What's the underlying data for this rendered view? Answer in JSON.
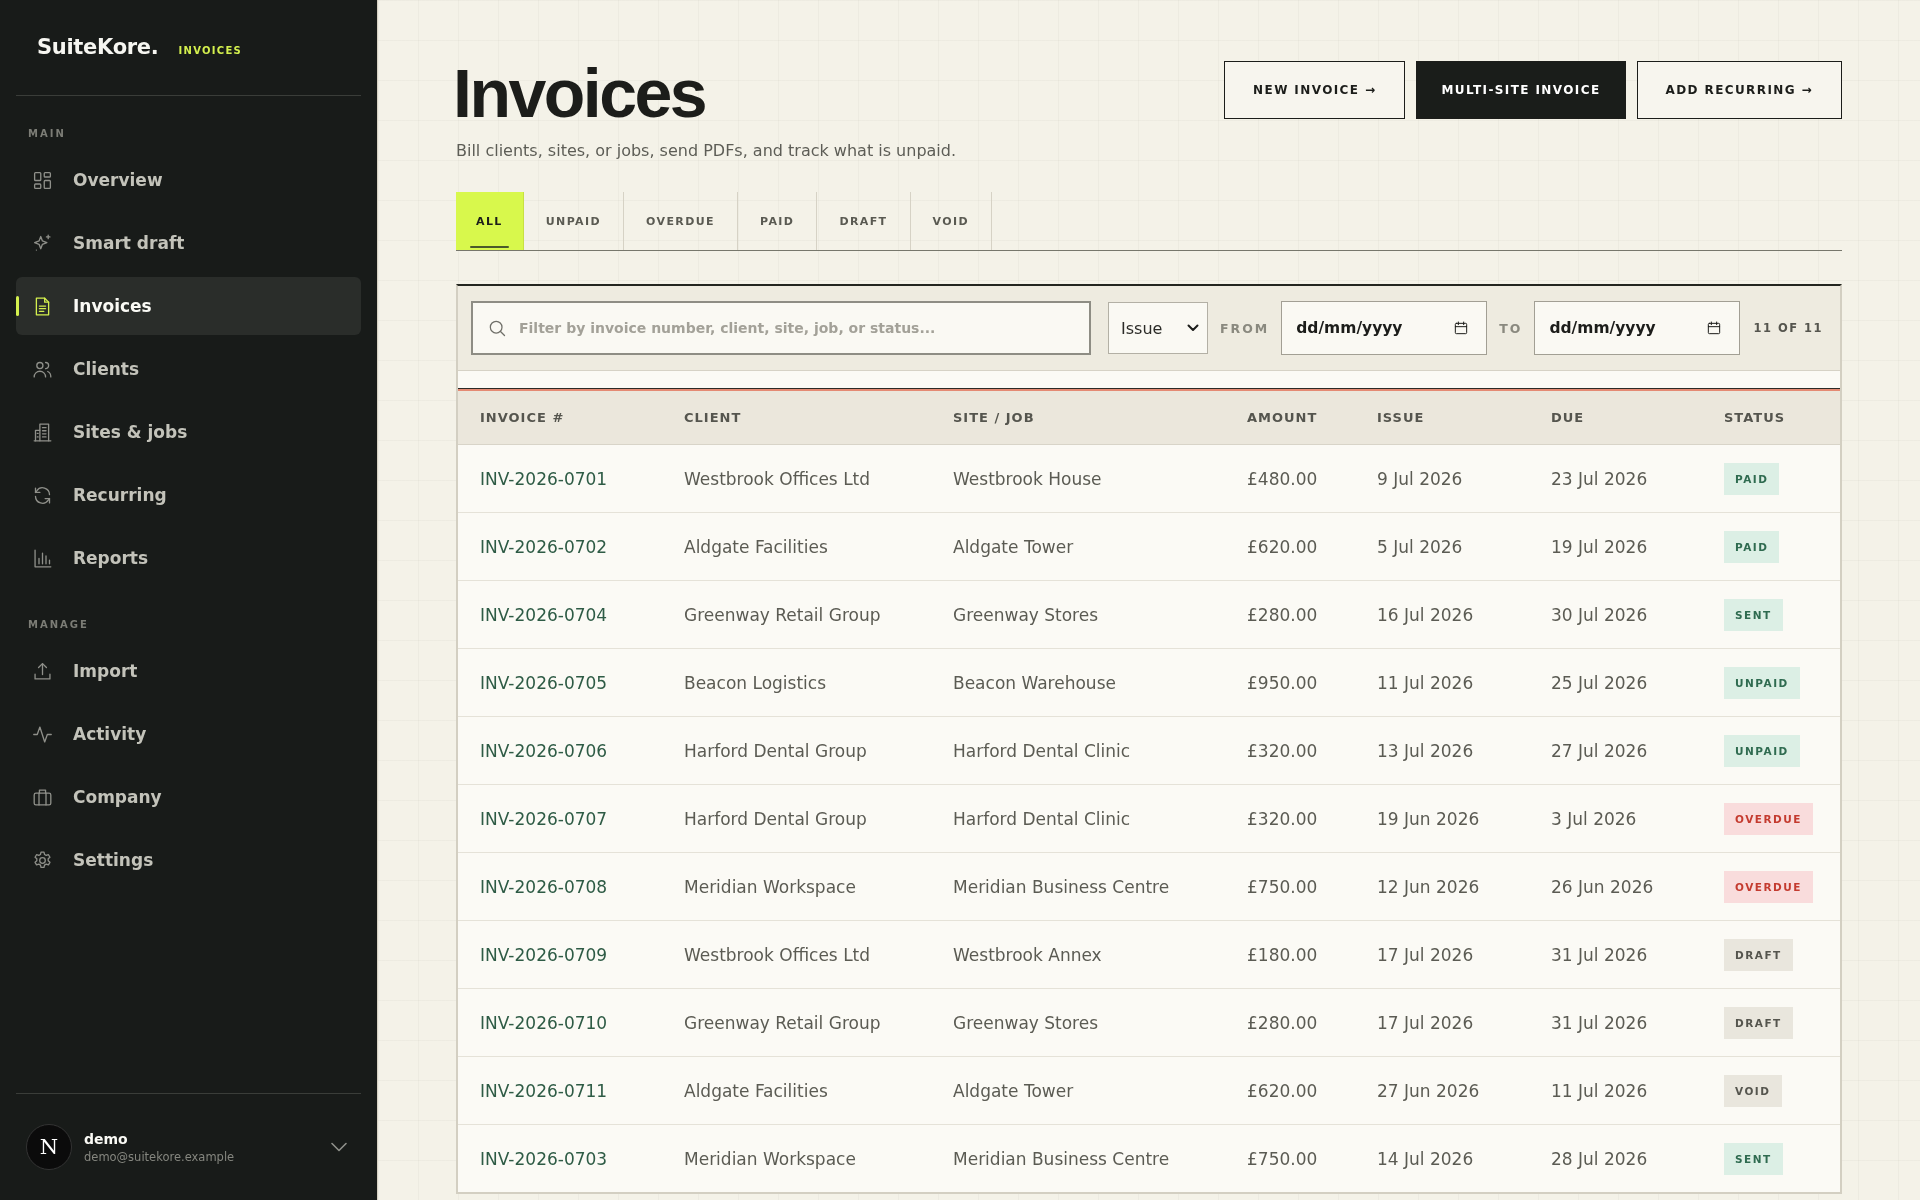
{
  "sidebar": {
    "brand": {
      "name": "SuiteKore.",
      "tag": "INVOICES"
    },
    "sections": [
      {
        "heading": "MAIN",
        "items": [
          {
            "label": "Overview",
            "selected": false
          },
          {
            "label": "Smart draft",
            "selected": false
          },
          {
            "label": "Invoices",
            "selected": true
          },
          {
            "label": "Clients",
            "selected": false
          },
          {
            "label": "Sites & jobs",
            "selected": false
          },
          {
            "label": "Recurring",
            "selected": false
          },
          {
            "label": "Reports",
            "selected": false
          }
        ]
      },
      {
        "heading": "MANAGE",
        "items": [
          {
            "label": "Import",
            "selected": false
          },
          {
            "label": "Activity",
            "selected": false
          },
          {
            "label": "Company",
            "selected": false
          },
          {
            "label": "Settings",
            "selected": false
          }
        ]
      }
    ],
    "user": {
      "avatar": "N",
      "name": "demo",
      "email": "demo@suitekore.example"
    }
  },
  "header": {
    "title": "Invoices",
    "subtitle": "Bill clients, sites, or jobs, send PDFs, and track what is unpaid.",
    "actions": [
      {
        "label": "NEW INVOICE →",
        "kind": "outline"
      },
      {
        "label": "MULTI-SITE INVOICE",
        "kind": "primary"
      },
      {
        "label": "ADD RECURRING →",
        "kind": "outline"
      }
    ]
  },
  "tabs": [
    {
      "label": "ALL",
      "selected": true
    },
    {
      "label": "UNPAID",
      "selected": false
    },
    {
      "label": "OVERDUE",
      "selected": false
    },
    {
      "label": "PAID",
      "selected": false
    },
    {
      "label": "DRAFT",
      "selected": false
    },
    {
      "label": "VOID",
      "selected": false
    }
  ],
  "filters": {
    "search": {
      "placeholder": "Filter by invoice number, client, site, job, or status..."
    },
    "date_type": {
      "value": "Issue"
    },
    "from": {
      "label": "FROM",
      "placeholder": "dd/mm/yyyy"
    },
    "to": {
      "label": "TO",
      "placeholder": "dd/mm/yyyy"
    },
    "count": "11 OF 11"
  },
  "table": {
    "columns": [
      "INVOICE #",
      "CLIENT",
      "SITE / JOB",
      "AMOUNT",
      "ISSUE",
      "DUE",
      "STATUS"
    ],
    "rows": [
      {
        "invoice": "INV-2026-0701",
        "client": "Westbrook Offices Ltd",
        "site_job": "Westbrook House",
        "amount": "£480.00",
        "issue": "9 Jul 2026",
        "due": "23 Jul 2026",
        "status": {
          "label": "PAID",
          "kind": "paid"
        }
      },
      {
        "invoice": "INV-2026-0702",
        "client": "Aldgate Facilities",
        "site_job": "Aldgate Tower",
        "amount": "£620.00",
        "issue": "5 Jul 2026",
        "due": "19 Jul 2026",
        "status": {
          "label": "PAID",
          "kind": "paid"
        }
      },
      {
        "invoice": "INV-2026-0704",
        "client": "Greenway Retail Group",
        "site_job": "Greenway Stores",
        "amount": "£280.00",
        "issue": "16 Jul 2026",
        "due": "30 Jul 2026",
        "status": {
          "label": "SENT",
          "kind": "sent"
        }
      },
      {
        "invoice": "INV-2026-0705",
        "client": "Beacon Logistics",
        "site_job": "Beacon Warehouse",
        "amount": "£950.00",
        "issue": "11 Jul 2026",
        "due": "25 Jul 2026",
        "status": {
          "label": "UNPAID",
          "kind": "unpaid"
        }
      },
      {
        "invoice": "INV-2026-0706",
        "client": "Harford Dental Group",
        "site_job": "Harford Dental Clinic",
        "amount": "£320.00",
        "issue": "13 Jul 2026",
        "due": "27 Jul 2026",
        "status": {
          "label": "UNPAID",
          "kind": "unpaid"
        }
      },
      {
        "invoice": "INV-2026-0707",
        "client": "Harford Dental Group",
        "site_job": "Harford Dental Clinic",
        "amount": "£320.00",
        "issue": "19 Jun 2026",
        "due": "3 Jul 2026",
        "status": {
          "label": "OVERDUE",
          "kind": "overdue"
        }
      },
      {
        "invoice": "INV-2026-0708",
        "client": "Meridian Workspace",
        "site_job": "Meridian Business Centre",
        "amount": "£750.00",
        "issue": "12 Jun 2026",
        "due": "26 Jun 2026",
        "status": {
          "label": "OVERDUE",
          "kind": "overdue"
        }
      },
      {
        "invoice": "INV-2026-0709",
        "client": "Westbrook Offices Ltd",
        "site_job": "Westbrook Annex",
        "amount": "£180.00",
        "issue": "17 Jul 2026",
        "due": "31 Jul 2026",
        "status": {
          "label": "DRAFT",
          "kind": "draft"
        }
      },
      {
        "invoice": "INV-2026-0710",
        "client": "Greenway Retail Group",
        "site_job": "Greenway Stores",
        "amount": "£280.00",
        "issue": "17 Jul 2026",
        "due": "31 Jul 2026",
        "status": {
          "label": "DRAFT",
          "kind": "draft"
        }
      },
      {
        "invoice": "INV-2026-0711",
        "client": "Aldgate Facilities",
        "site_job": "Aldgate Tower",
        "amount": "£620.00",
        "issue": "27 Jun 2026",
        "due": "11 Jul 2026",
        "status": {
          "label": "VOID",
          "kind": "void"
        }
      },
      {
        "invoice": "INV-2026-0703",
        "client": "Meridian Workspace",
        "site_job": "Meridian Business Centre",
        "amount": "£750.00",
        "issue": "14 Jul 2026",
        "due": "28 Jul 2026",
        "status": {
          "label": "SENT",
          "kind": "sent"
        }
      }
    ]
  }
}
